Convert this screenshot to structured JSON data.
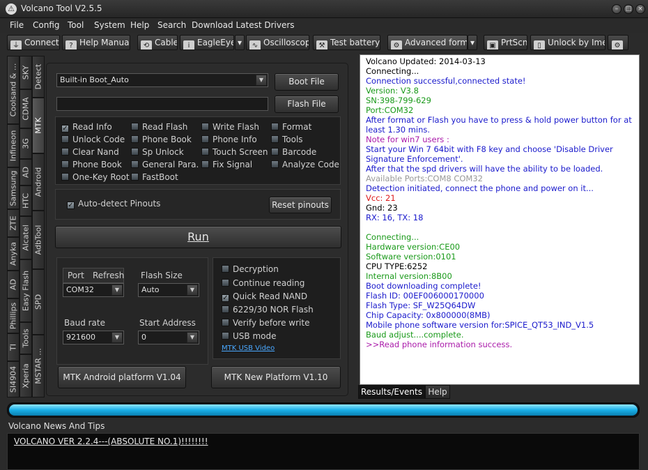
{
  "window": {
    "title": "Volcano Tool V2.5.5"
  },
  "menu": [
    "File",
    "Config",
    "Tool",
    "System",
    "Help",
    "Search",
    "Download Latest Drivers"
  ],
  "toolbar": {
    "connect": "Connect",
    "help_manuals": "Help Manuals",
    "cable": "Cable",
    "eagleeye": "EagleEye",
    "oscilloscope": "Oscilloscope",
    "test_battery": "Test battery",
    "advanced_form": "Advanced form",
    "prtscn": "PrtScn",
    "unlock_imei": "Unlock by Imei"
  },
  "vtabs": {
    "col1": [
      "Coolsand & ...",
      "Infineon",
      "Samsung",
      "ZTE",
      "Anyka",
      "AD",
      "Phillips",
      "TI",
      "SI4904"
    ],
    "col2": [
      "SKY",
      "CDMA",
      "3G",
      "AD",
      "HTC",
      "Alcatel",
      "Easy Flash",
      "Tools",
      "Xperia"
    ],
    "col3": [
      "Detect",
      "MTK",
      "Android",
      "AdbTool",
      "SPD",
      "MSTAR ..."
    ]
  },
  "boot": {
    "selected": "Built-in Boot_Auto",
    "boot_file": "Boot File",
    "flash_file": "Flash File",
    "flash_path": ""
  },
  "ops": [
    {
      "label": "Read Info",
      "checked": true
    },
    {
      "label": "Read Flash",
      "checked": false
    },
    {
      "label": "Write Flash",
      "checked": false
    },
    {
      "label": "Format",
      "checked": false
    },
    {
      "label": "Unlock Code",
      "checked": false
    },
    {
      "label": "Phone Book",
      "checked": false
    },
    {
      "label": "Phone Info",
      "checked": false
    },
    {
      "label": "Tools",
      "checked": false
    },
    {
      "label": "Clear Nand",
      "checked": false
    },
    {
      "label": "Sp Unlock",
      "checked": false
    },
    {
      "label": "Touch Screen",
      "checked": false
    },
    {
      "label": "Barcode",
      "checked": false
    },
    {
      "label": "Phone Book",
      "checked": false
    },
    {
      "label": "General Para.",
      "checked": false
    },
    {
      "label": "Fix Signal",
      "checked": false
    },
    {
      "label": "Analyze Code",
      "checked": false
    },
    {
      "label": "One-Key Root",
      "checked": false
    },
    {
      "label": "FastBoot",
      "checked": false
    }
  ],
  "pinouts": {
    "auto_detect": "Auto-detect Pinouts",
    "reset": "Reset pinouts"
  },
  "run": "Run",
  "port": {
    "port_label": "Port",
    "refresh_label": "Refresh",
    "port_value": "COM32",
    "flash_size_label": "Flash Size",
    "flash_size_value": "Auto",
    "baud_label": "Baud rate",
    "baud_value": "921600",
    "start_addr_label": "Start Address",
    "start_addr_value": "0"
  },
  "options": [
    {
      "label": "Decryption",
      "checked": false
    },
    {
      "label": "Continue reading",
      "checked": false
    },
    {
      "label": "Quick Read NAND",
      "checked": true
    },
    {
      "label": "6229/30 NOR Flash",
      "checked": false
    },
    {
      "label": "Verify before write",
      "checked": false
    },
    {
      "label": "USB mode",
      "checked": false
    }
  ],
  "mtk_usb_video": "MTK USB Video",
  "platform": {
    "android": "MTK Android platform V1.04",
    "new": "MTK New Platform V1.10"
  },
  "log": [
    {
      "text": "Volcano Updated: 2014-03-13",
      "color": "#000000"
    },
    {
      "text": "Connecting...",
      "color": "#000000"
    },
    {
      "text": "Connection successful,connected state!",
      "color": "#1a1acc"
    },
    {
      "text": "Version: V3.8",
      "color": "#1a9a1a"
    },
    {
      "text": "SN:398-799-629",
      "color": "#1a9a1a"
    },
    {
      "text": "Port:COM32",
      "color": "#1a9a1a"
    },
    {
      "text": "After format or Flash you have to press & hold power button for at least 1.30 mins.",
      "color": "#1a1acc"
    },
    {
      "text": "Note for win7 users :",
      "color": "#aa1aaa"
    },
    {
      "text": "Start your Win 7 64bit with F8 key and choose 'Disable Driver Signature Enforcement'.",
      "color": "#1a1acc"
    },
    {
      "text": "After that the spd drivers will have the ability to be loaded.",
      "color": "#1a1acc"
    },
    {
      "text": "Available Ports:COM8 COM32",
      "color": "#999999"
    },
    {
      "text": "Detection initiated, connect the phone and power on it...",
      "color": "#1a1acc"
    },
    {
      "text": "Vcc: 21",
      "color": "#dd1a1a"
    },
    {
      "text": "Gnd: 23",
      "color": "#000000"
    },
    {
      "text": "RX: 16, TX: 18",
      "color": "#1a1acc"
    },
    {
      "text": "",
      "color": "#000000"
    },
    {
      "text": "Connecting...",
      "color": "#1a9a1a"
    },
    {
      "text": "Hardware version:CE00",
      "color": "#1a9a1a"
    },
    {
      "text": "Software version:0101",
      "color": "#1a9a1a"
    },
    {
      "text": "CPU TYPE:6252",
      "color": "#000000"
    },
    {
      "text": "Internal version:8B00",
      "color": "#1a9a1a"
    },
    {
      "text": "Boot downloading complete!",
      "color": "#1a1acc"
    },
    {
      "text": "Flash ID: 00EF006000170000",
      "color": "#1a1acc"
    },
    {
      "text": "Flash Type: SF_W25Q64DW",
      "color": "#1a1acc"
    },
    {
      "text": "Chip Capacity: 0x800000(8MB)",
      "color": "#1a1acc"
    },
    {
      "text": "Mobile phone software version for:SPICE_QT53_IND_V1.5",
      "color": "#1a1acc"
    },
    {
      "text": "Baud adjust....complete.",
      "color": "#1a9a1a"
    },
    {
      "text": ">>Read phone information success.",
      "color": "#aa1aaa"
    }
  ],
  "result_tabs": {
    "results": "Results/Events",
    "help": "Help"
  },
  "progress": {
    "percent": 100
  },
  "news": {
    "title": "Volcano News And Tips",
    "headline": "VOLCANO VER 2.2.4---(ABSOLUTE NO.1)!!!!!!!!"
  }
}
